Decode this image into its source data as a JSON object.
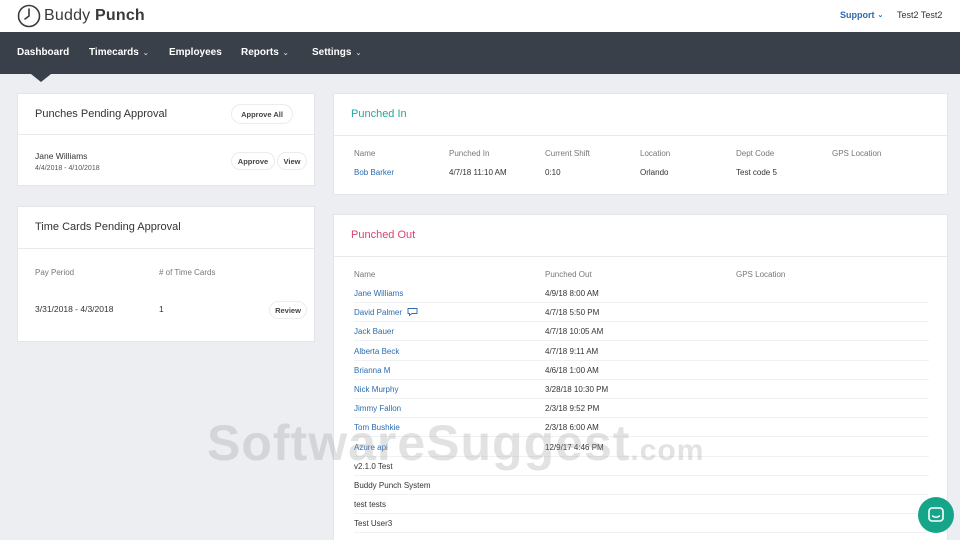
{
  "brand": {
    "name_light": "Buddy ",
    "name_bold": "Punch"
  },
  "header": {
    "support_label": "Support",
    "user_name": "Test2 Test2"
  },
  "nav": {
    "items": [
      {
        "label": "Dashboard",
        "has_caret": false
      },
      {
        "label": "Timecards",
        "has_caret": true
      },
      {
        "label": "Employees",
        "has_caret": false
      },
      {
        "label": "Reports",
        "has_caret": true
      },
      {
        "label": "Settings",
        "has_caret": true
      }
    ]
  },
  "punches_pending": {
    "title": "Punches Pending Approval",
    "approve_all_label": "Approve All",
    "entry": {
      "name": "Jane Williams",
      "dates": "4/4/2018 - 4/10/2018",
      "approve_label": "Approve",
      "view_label": "View"
    }
  },
  "timecards_pending": {
    "title": "Time Cards Pending Approval",
    "headers": [
      "Pay Period",
      "# of Time Cards"
    ],
    "row": {
      "period": "3/31/2018 - 4/3/2018",
      "count": "1",
      "review_label": "Review"
    }
  },
  "punched_in": {
    "title": "Punched In",
    "headers": [
      "Name",
      "Punched In",
      "Current Shift",
      "Location",
      "Dept Code",
      "GPS Location"
    ],
    "row": {
      "name": "Bob Barker",
      "punched_in": "4/7/18 11:10 AM",
      "shift": "0:10",
      "location": "Orlando",
      "dept": "Test code 5",
      "gps": ""
    }
  },
  "punched_out": {
    "title": "Punched Out",
    "headers": [
      "Name",
      "Punched Out",
      "GPS Location"
    ],
    "rows": [
      {
        "name": "Jane Williams",
        "time": "4/9/18 8:00 AM",
        "link": true
      },
      {
        "name": "David Palmer",
        "time": "4/7/18 5:50 PM",
        "link": true
      },
      {
        "name": "Jack Bauer",
        "time": "4/7/18 10:05 AM",
        "link": true
      },
      {
        "name": "Alberta Beck",
        "time": "4/7/18 9:11 AM",
        "link": true
      },
      {
        "name": "Brianna M",
        "time": "4/6/18 1:00 AM",
        "link": true
      },
      {
        "name": "Nick Murphy",
        "time": "3/28/18 10:30 PM",
        "link": true
      },
      {
        "name": "Jimmy Fallon",
        "time": "2/3/18 9:52 PM",
        "link": true
      },
      {
        "name": "Tom Bushkie",
        "time": "2/3/18 6:00 AM",
        "link": true
      },
      {
        "name": "Azure api",
        "time": "12/9/17 4:46 PM",
        "link": true
      },
      {
        "name": "v2.1.0 Test",
        "time": "",
        "link": false
      },
      {
        "name": "Buddy Punch System",
        "time": "",
        "link": false
      },
      {
        "name": "test tests",
        "time": "",
        "link": false
      },
      {
        "name": "Test User3",
        "time": "",
        "link": false
      }
    ]
  },
  "watermark": {
    "main": "SoftwareSuggest",
    "suffix": ".com"
  },
  "colors": {
    "nav_bg": "#3a4049",
    "teal": "#25a79a",
    "pink": "#d8456e",
    "link": "#2b6cb0",
    "chat": "#17a589"
  }
}
